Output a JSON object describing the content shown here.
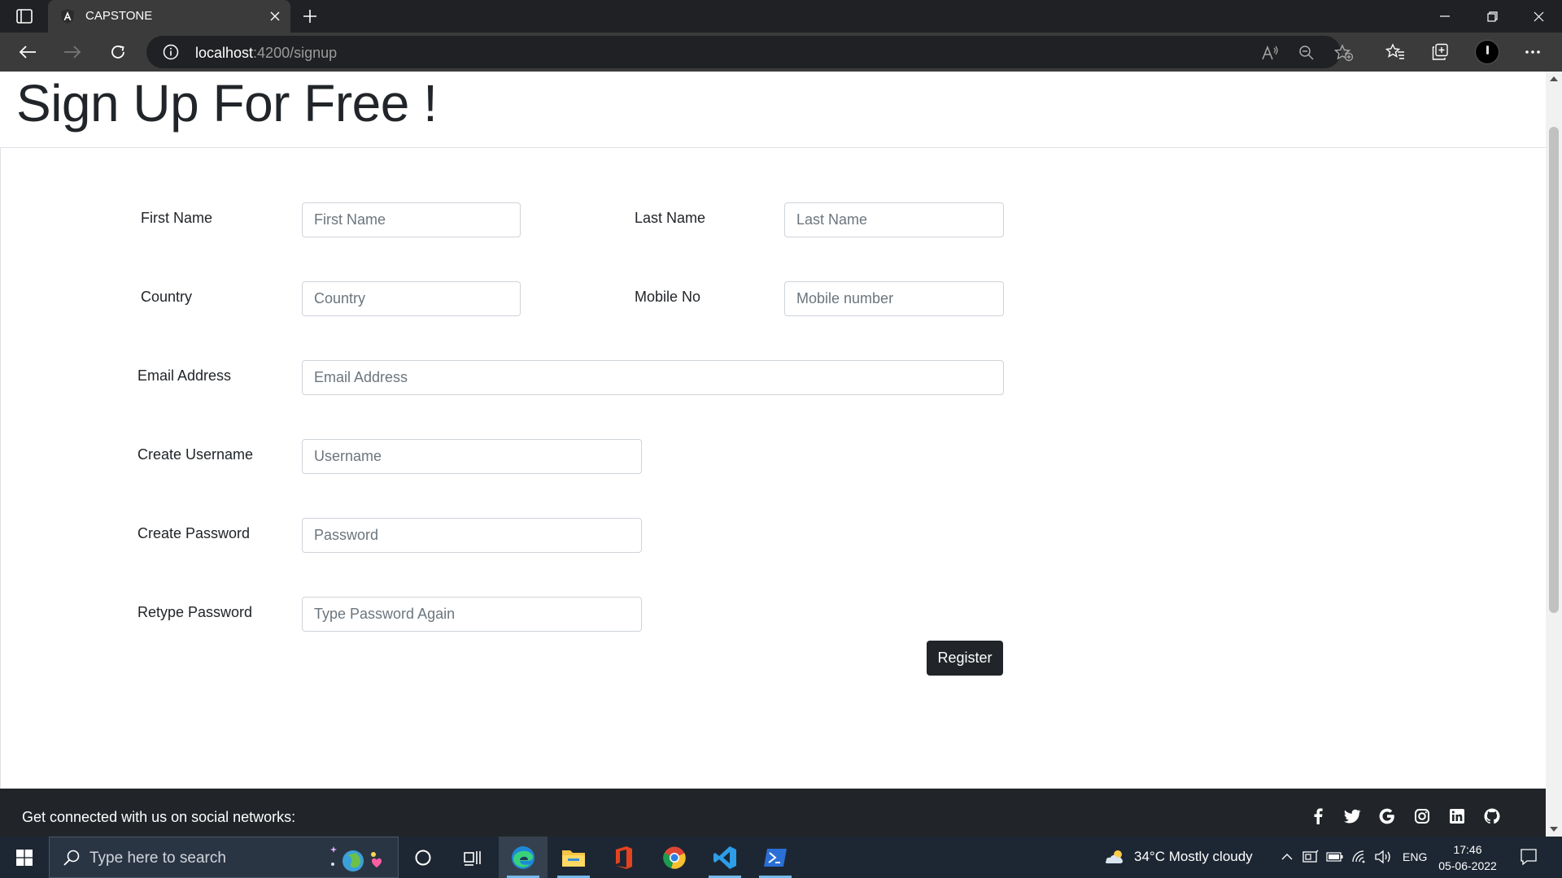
{
  "browser": {
    "tab_title": "CAPSTONE",
    "url_host": "localhost",
    "url_rest": ":4200/signup"
  },
  "page": {
    "title": "Sign Up For Free !",
    "form": {
      "first_name": {
        "label": "First Name",
        "placeholder": "First Name"
      },
      "last_name": {
        "label": "Last Name",
        "placeholder": "Last Name"
      },
      "country": {
        "label": "Country",
        "placeholder": "Country"
      },
      "mobile": {
        "label": "Mobile No",
        "placeholder": "Mobile number"
      },
      "email": {
        "label": "Email Address",
        "placeholder": "Email Address"
      },
      "username": {
        "label": "Create Username",
        "placeholder": "Username"
      },
      "password": {
        "label": "Create Password",
        "placeholder": "Password"
      },
      "retype": {
        "label": "Retype Password",
        "placeholder": "Type Password Again"
      },
      "register_label": "Register"
    },
    "footer": {
      "text": "Get connected with us on social networks:",
      "socials": [
        "facebook-icon",
        "twitter-icon",
        "google-icon",
        "instagram-icon",
        "linkedin-icon",
        "github-icon"
      ]
    }
  },
  "taskbar": {
    "search_placeholder": "Type here to search",
    "weather": "34°C  Mostly cloudy",
    "language": "ENG",
    "time": "17:46",
    "date": "05-06-2022"
  },
  "colors": {
    "dark": "#212529",
    "browser_bg": "#202124",
    "toolbar_bg": "#3b3b3b",
    "taskbar_bg": "#1d2733"
  }
}
